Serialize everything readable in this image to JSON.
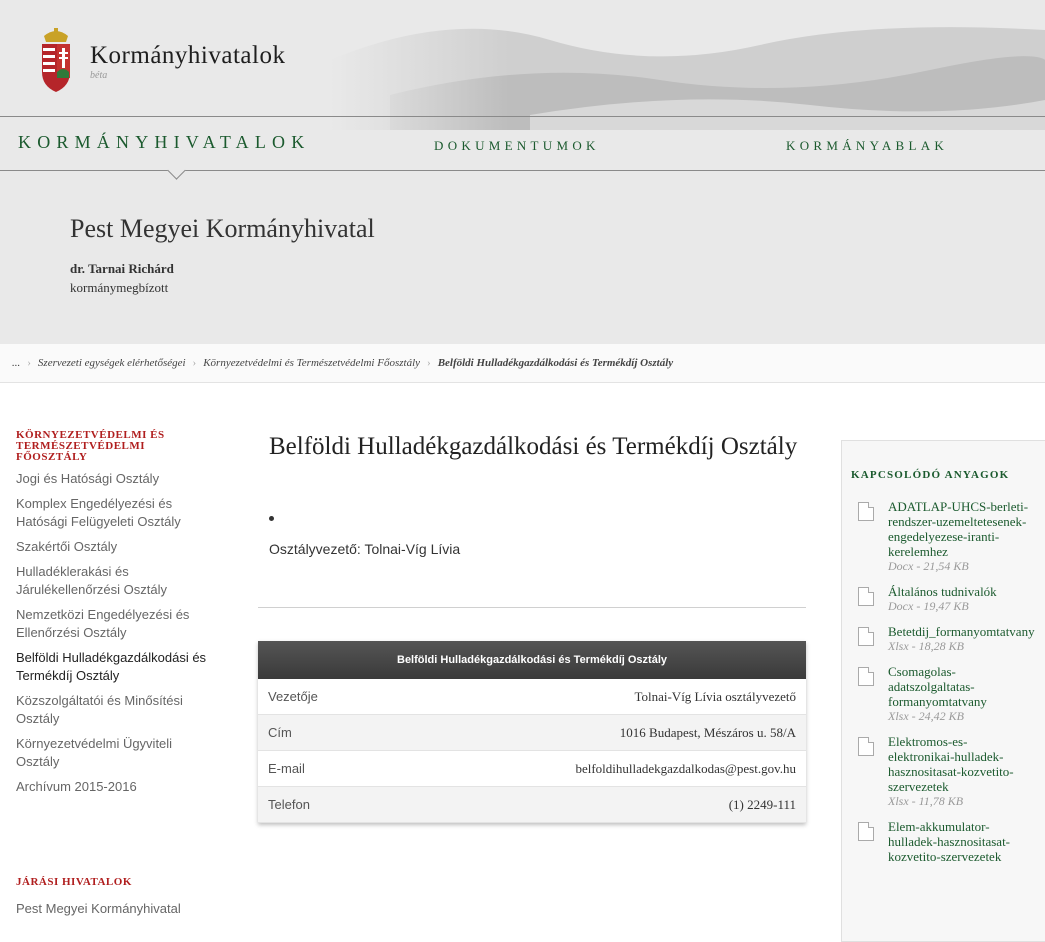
{
  "header": {
    "site_title": "Kormányhivatalok",
    "beta": "béta"
  },
  "nav": [
    {
      "label": "Kormányhivatalok"
    },
    {
      "label": "Dokumentumok"
    },
    {
      "label": "Kormányablak"
    }
  ],
  "org": {
    "title": "Pest Megyei Kormányhivatal",
    "head_name": "dr. Tarnai Richárd",
    "head_role": "kormánymegbízott"
  },
  "breadcrumb": {
    "ellipsis": "...",
    "items": [
      "Szervezeti egységek elérhetőségei",
      "Környezetvédelmi és Természetvédelmi Főosztály",
      "Belföldi Hulladékgazdálkodási és Termékdíj Osztály"
    ]
  },
  "sidebar": {
    "heading": "Környezetvédelmi és Természetvédelmi Főosztály",
    "items": [
      "Jogi és Hatósági Osztály",
      "Komplex Engedélyezési és Hatósági Felügyeleti Osztály",
      "Szakértői Osztály",
      "Hulladéklerakási és Járulékellenőrzési Osztály",
      "Nemzetközi Engedélyezési és Ellenőrzési Osztály",
      "Belföldi Hulladékgazdálkodási és Termékdíj Osztály",
      "Közszolgáltatói és Minősítési Osztály",
      "Környezetvédelmi Ügyviteli Osztály",
      "Archívum 2015-2016"
    ],
    "heading2": "Járási hivatalok",
    "item2": "Pest Megyei Kormányhivatal"
  },
  "main": {
    "title": "Belföldi Hulladékgazdálkodási és Termékdíj Osztály",
    "leader": "Osztályvezető: Tolnai-Víg Lívia",
    "table": {
      "header": "Belföldi Hulladékgazdálkodási és Termékdíj Osztály",
      "rows": [
        {
          "label": "Vezetője",
          "value": "Tolnai-Víg Lívia osztályvezető"
        },
        {
          "label": "Cím",
          "value": "1016 Budapest, Mészáros u. 58/A"
        },
        {
          "label": "E-mail",
          "value": "belfoldihulladekgazdalkodas@pest.gov.hu"
        },
        {
          "label": "Telefon",
          "value": "(1) 2249-111"
        }
      ]
    }
  },
  "related": {
    "title": "Kapcsolódó anyagok",
    "docs": [
      {
        "name": "ADATLAP-UHCS-berleti-\nrendszer-uzemeltetesenek-\nengedelyezese-iranti-\nkerelemhez",
        "meta": "Docx - 21,54 KB"
      },
      {
        "name": "Általános tudnivalók",
        "meta": "Docx - 19,47 KB"
      },
      {
        "name": "Betetdij_formanyomtatvany",
        "meta": "Xlsx - 18,28 KB"
      },
      {
        "name": "Csomagolas-\nadatszolgaltatas-\nformanyomtatvany",
        "meta": "Xlsx - 24,42 KB"
      },
      {
        "name": "Elektromos-es-\nelektronikai-hulladek-\nhasznositasat-kozvetito-\nszervezetek",
        "meta": "Xlsx - 11,78 KB"
      },
      {
        "name": "Elem-akkumulator-\nhulladek-hasznositasat-\nkozvetito-szervezetek",
        "meta": ""
      }
    ]
  }
}
